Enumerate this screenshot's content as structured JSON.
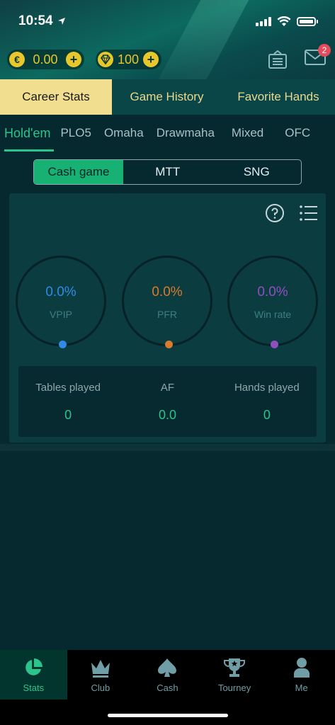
{
  "status_bar": {
    "time": "10:54"
  },
  "wallet": {
    "gold": {
      "symbol": "€",
      "amount": "0.00"
    },
    "diamond": {
      "amount": "100"
    }
  },
  "header": {
    "mail_badge": "2"
  },
  "main_tabs": [
    {
      "label": "Career Stats",
      "active": true
    },
    {
      "label": "Game History",
      "active": false
    },
    {
      "label": "Favorite Hands",
      "active": false
    }
  ],
  "game_tabs": [
    {
      "label": "Hold'em",
      "active": true
    },
    {
      "label": "PLO5"
    },
    {
      "label": "Omaha"
    },
    {
      "label": "Drawmaha"
    },
    {
      "label": "Mixed"
    },
    {
      "label": "OFC"
    }
  ],
  "segments": [
    {
      "label": "Cash game",
      "active": true
    },
    {
      "label": "MTT"
    },
    {
      "label": "SNG"
    }
  ],
  "stats": {
    "vpip": {
      "value": "0.0%",
      "label": "VPIP"
    },
    "pfr": {
      "value": "0.0%",
      "label": "PFR"
    },
    "win_rate": {
      "value": "0.0%",
      "label": "Win rate"
    }
  },
  "totals": {
    "tables": {
      "label": "Tables played",
      "value": "0"
    },
    "af": {
      "label": "AF",
      "value": "0.0"
    },
    "hands": {
      "label": "Hands played",
      "value": "0"
    }
  },
  "nav": [
    {
      "label": "Stats",
      "icon": "pie-chart-icon",
      "active": true
    },
    {
      "label": "Club",
      "icon": "crown-icon"
    },
    {
      "label": "Cash",
      "icon": "spade-icon"
    },
    {
      "label": "Tourney",
      "icon": "trophy-icon"
    },
    {
      "label": "Me",
      "icon": "person-icon"
    }
  ],
  "colors": {
    "accent_green": "#2cc48a",
    "tab_gold": "#f1df8f",
    "vpip_blue": "#2f8ae8",
    "pfr_orange": "#d97a2c",
    "winrate_purple": "#8f4fc0",
    "coin_yellow": "#e8c72a",
    "badge_red": "#e54b5a"
  }
}
